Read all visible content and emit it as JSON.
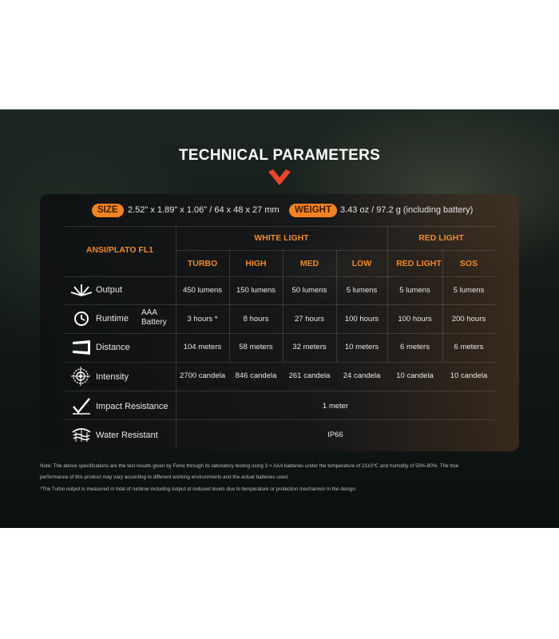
{
  "title": "TECHNICAL PARAMETERS",
  "specs": {
    "size_label": "SIZE",
    "size_value": "2.52\" x 1.89\" x 1.06\" / 64 x 48 x 27 mm",
    "weight_label": "WEIGHT",
    "weight_value": "3.43 oz / 97.2 g (including battery)"
  },
  "table": {
    "standard": "ANSI/PLATO FL1",
    "groups": [
      "WHITE LIGHT",
      "RED LIGHT"
    ],
    "modes": [
      "TURBO",
      "HIGH",
      "MED",
      "LOW",
      "RED LIGHT",
      "SOS"
    ],
    "rows": [
      {
        "label": "Output",
        "icon": "burst-icon",
        "values": [
          "450 lumens",
          "150 lumens",
          "50 lumens",
          "5 lumens",
          "5 lumens",
          "5 lumens"
        ]
      },
      {
        "label": "Runtime",
        "sub_label": [
          "AAA",
          "Battery"
        ],
        "icon": "clock-icon",
        "values": [
          "3 hours *",
          "8 hours",
          "27 hours",
          "100  hours",
          "100  hours",
          "200 hours"
        ]
      },
      {
        "label": "Distance",
        "icon": "beam-icon",
        "values": [
          "104 meters",
          "58 meters",
          "32 meters",
          "10 meters",
          "6 meters",
          "6 meters"
        ]
      },
      {
        "label": "Intensity",
        "icon": "target-icon",
        "values": [
          "2700 candela",
          "846 candela",
          "261 candela",
          "24 candela",
          "10 candela",
          "10 candela"
        ]
      },
      {
        "label": "Impact Resistance",
        "icon": "impact-icon",
        "span_value": "1 meter"
      },
      {
        "label": "Water Resistant",
        "icon": "water-icon",
        "span_value": "IP66"
      }
    ]
  },
  "notes": [
    "Note: The above specifications are the test results given by Fenix through its laboratory testing using 3 × AAA batteries under the temperature of 21±3℃ and humidity of 50%-80%. The true",
    "performance of this product may vary according to different working environments and the actual batteries used.",
    "*The Turbo output is measured in total of runtime including output at reduced levels due to temperature or protection mechanism in the design."
  ],
  "colors": {
    "accent": "#f58220"
  }
}
